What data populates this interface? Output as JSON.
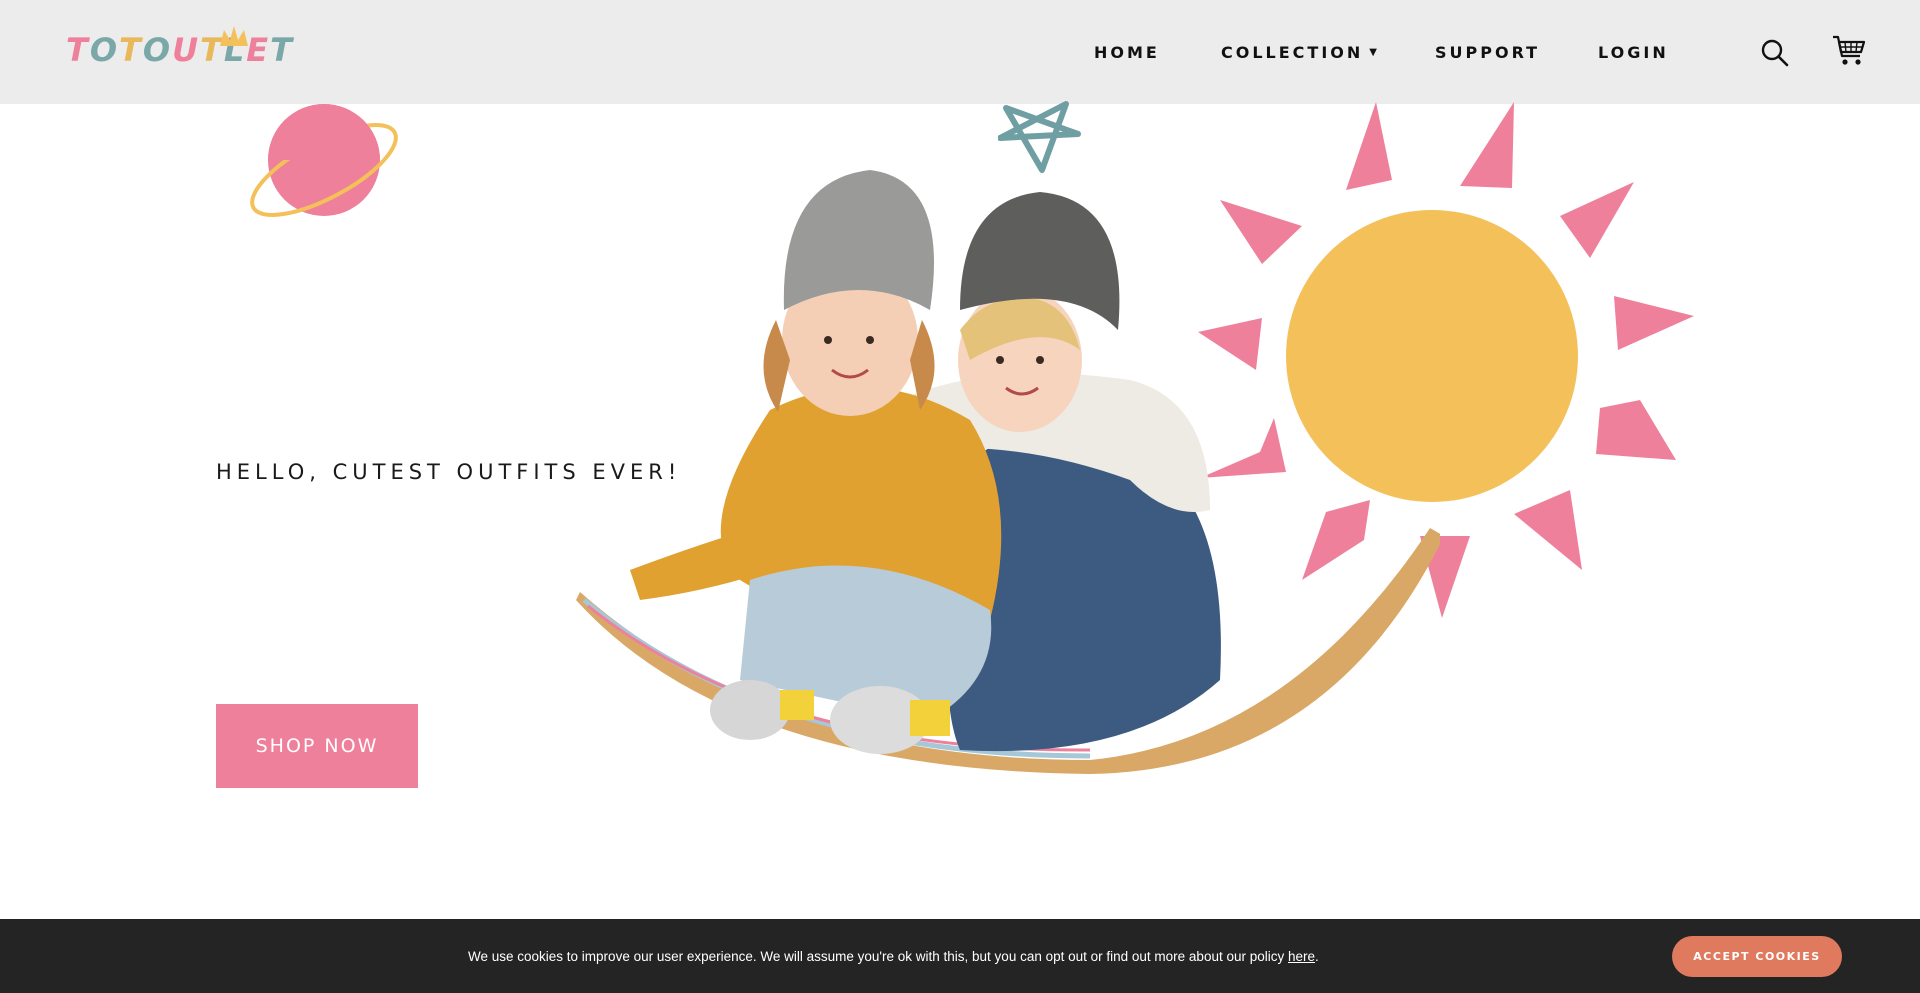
{
  "brand": {
    "logo_text": "TOTOUTLET",
    "logo_colors": [
      "#ef809c",
      "#7aa7a8",
      "#e9b85a",
      "#7aa7a8",
      "#ef809c",
      "#e9b85a",
      "#7aa7a8",
      "#ef809c",
      "#7aa7a8"
    ]
  },
  "nav": {
    "home": "HOME",
    "collection": "COLLECTION",
    "collection_caret": "▼",
    "support": "SUPPORT",
    "login": "LOGIN"
  },
  "header_icons": {
    "search": "search-icon",
    "cart": "cart-icon"
  },
  "hero": {
    "heading": "HELLO, CUTEST OUTFITS EVER!",
    "cta": "SHOP NOW"
  },
  "cookie": {
    "message_before": "We use cookies to improve our user experience. We will assume you're ok with this, but you can opt out or find out more about our policy ",
    "link_text": "here",
    "message_after": ".",
    "accept_label": "ACCEPT COOKIES"
  },
  "colors": {
    "header_bg": "#ececec",
    "pink": "#ef809c",
    "yellow": "#f4c05a",
    "teal": "#6f9fa3",
    "cookie_bg": "#242424",
    "accept_bg": "#e07a5f"
  }
}
